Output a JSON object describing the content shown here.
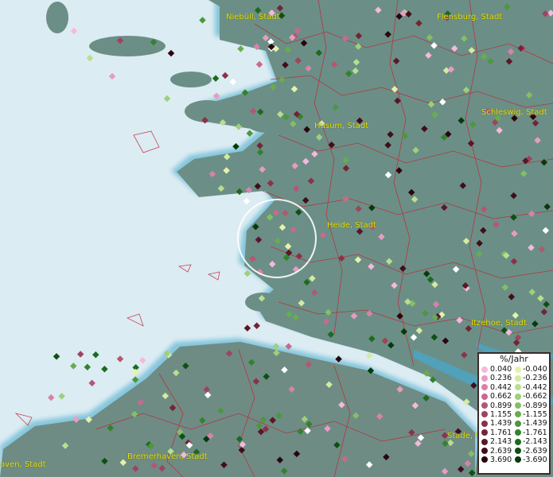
{
  "map": {
    "cities": [
      {
        "id": "niebuell",
        "label": "Niebüll, Stadt"
      },
      {
        "id": "flensburg",
        "label": "Flensburg, Stadt"
      },
      {
        "id": "husum",
        "label": "Husum, Stadt"
      },
      {
        "id": "schleswig",
        "label": "Schleswig, Stadt"
      },
      {
        "id": "heide",
        "label": "Heide, Stadt"
      },
      {
        "id": "itzehoe",
        "label": "Itzehoe, Stadt"
      },
      {
        "id": "stade",
        "label": "Stade, S"
      },
      {
        "id": "bremerhaven",
        "label": "Bremerhaven, Stadt"
      },
      {
        "id": "cuxhaven",
        "label": "aven, Stadt"
      }
    ],
    "colors": {
      "sea": "#dcecf3",
      "land": "#6b8f86",
      "shore": "#3fa7c9",
      "borders": "#c0263a",
      "city_label": "#e8e000"
    }
  },
  "legend": {
    "title": "%/Jahr",
    "rows": [
      {
        "pos": "0.040",
        "neg": "-0.040",
        "pos_color": "#f7b8dc",
        "neg_color": "#e6f2a8"
      },
      {
        "pos": "0.236",
        "neg": "-0.236",
        "pos_color": "#e89cc2",
        "neg_color": "#d2eba0"
      },
      {
        "pos": "0.442",
        "neg": "-0.442",
        "pos_color": "#d882a8",
        "neg_color": "#b9de8e"
      },
      {
        "pos": "0.662",
        "neg": "-0.662",
        "pos_color": "#c66a8e",
        "neg_color": "#9dd07a"
      },
      {
        "pos": "0.899",
        "neg": "-0.899",
        "pos_color": "#b45674",
        "neg_color": "#82c064"
      },
      {
        "pos": "1.155",
        "neg": "-1.155",
        "pos_color": "#9f435e",
        "neg_color": "#67ad4e"
      },
      {
        "pos": "1.439",
        "neg": "-1.439",
        "pos_color": "#8a3249",
        "neg_color": "#4c983c"
      },
      {
        "pos": "1.761",
        "neg": "-1.761",
        "pos_color": "#732436",
        "neg_color": "#33822d"
      },
      {
        "pos": "2.143",
        "neg": "-2.143",
        "pos_color": "#5a1726",
        "neg_color": "#1d6a1f"
      },
      {
        "pos": "2.639",
        "neg": "-2.639",
        "pos_color": "#420d19",
        "neg_color": "#0e5014"
      },
      {
        "pos": "3.690",
        "neg": "-3.690",
        "pos_color": "#2a050d",
        "neg_color": "#063a0c"
      }
    ]
  }
}
